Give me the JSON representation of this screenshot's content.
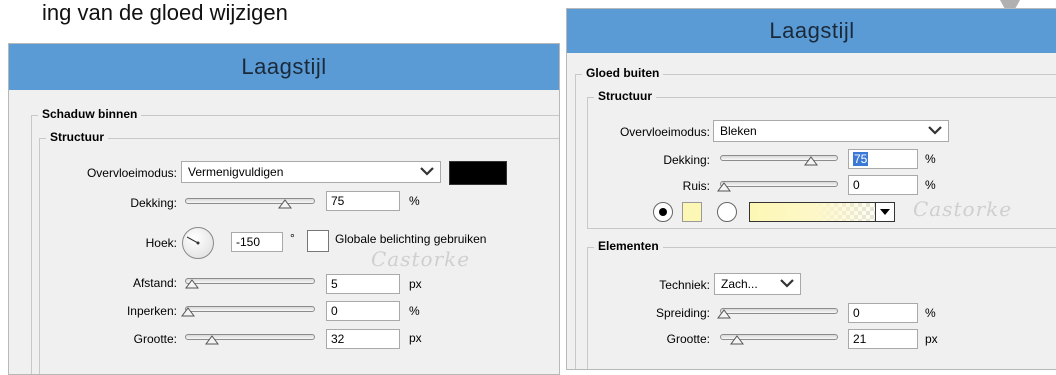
{
  "background_title": "ing van de gloed wijzigen",
  "left_dialog": {
    "title": "Laagstijl",
    "section": "Schaduw binnen",
    "subsection": "Structuur",
    "blend_mode_label": "Overvloeimodus:",
    "blend_mode_value": "Vermenigvuldigen",
    "blend_color": "#000000",
    "opacity_label": "Dekking:",
    "opacity_value": "75",
    "opacity_unit": "%",
    "angle_label": "Hoek:",
    "angle_value": "-150",
    "angle_unit": "°",
    "global_light_label": "Globale belichting gebruiken",
    "distance_label": "Afstand:",
    "distance_value": "5",
    "distance_unit": "px",
    "choke_label": "Inperken:",
    "choke_value": "0",
    "choke_unit": "%",
    "size_label": "Grootte:",
    "size_value": "32",
    "size_unit": "px",
    "watermark": "Castorke"
  },
  "right_dialog": {
    "title": "Laagstijl",
    "section": "Gloed buiten",
    "subsection": "Structuur",
    "blend_mode_label": "Overvloeimodus:",
    "blend_mode_value": "Bleken",
    "opacity_label": "Dekking:",
    "opacity_value": "75",
    "opacity_unit": "%",
    "noise_label": "Ruis:",
    "noise_value": "0",
    "noise_unit": "%",
    "glow_color": "#fdf7b5",
    "watermark": "Castorke",
    "elements_section": "Elementen",
    "technique_label": "Techniek:",
    "technique_value": "Zach...",
    "spread_label": "Spreiding:",
    "spread_value": "0",
    "spread_unit": "%",
    "size_label": "Grootte:",
    "size_value": "21",
    "size_unit": "px"
  },
  "colors": {
    "titlebar": "#5b9bd5",
    "dialog_bg": "#f0f0f0",
    "selection": "#3b79d6"
  }
}
